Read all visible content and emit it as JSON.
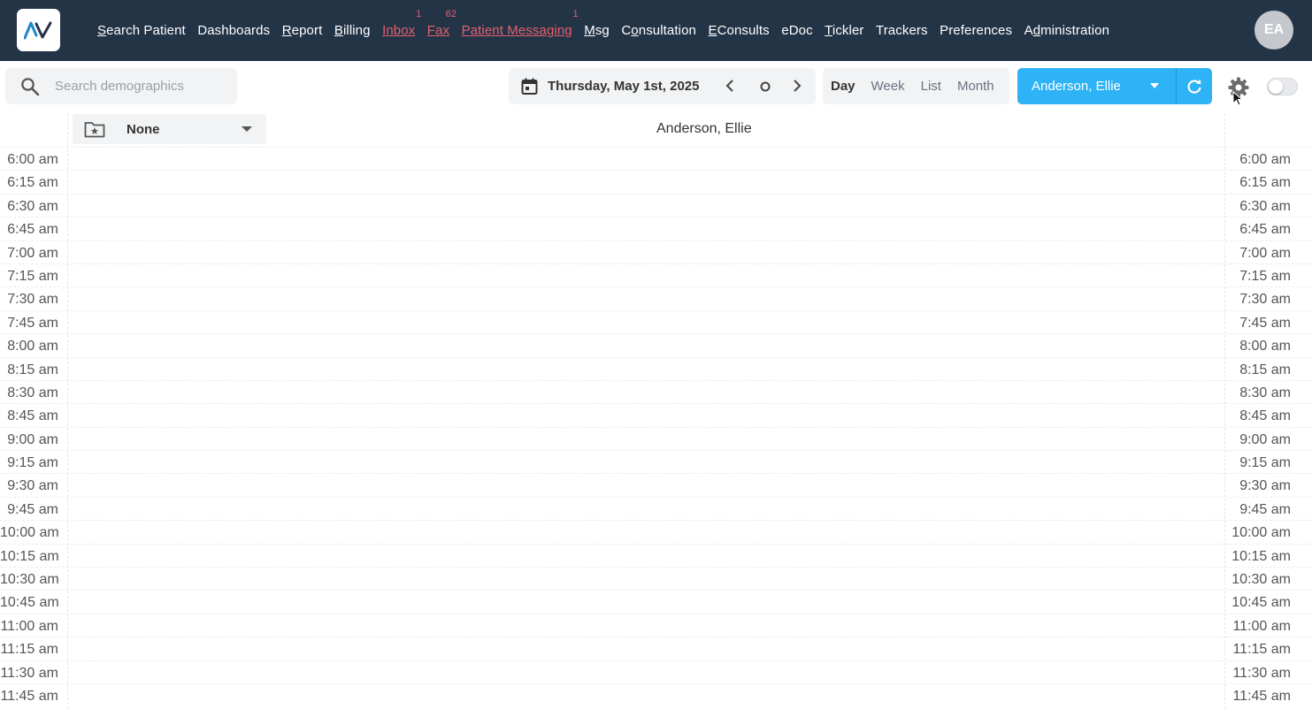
{
  "nav": {
    "items": [
      {
        "pre": "",
        "u": "S",
        "post": "earch Patient",
        "alert": false,
        "badge": ""
      },
      {
        "pre": "Dashboards",
        "u": "",
        "post": "",
        "alert": false,
        "badge": ""
      },
      {
        "pre": "",
        "u": "R",
        "post": "eport",
        "alert": false,
        "badge": ""
      },
      {
        "pre": "",
        "u": "B",
        "post": "illing",
        "alert": false,
        "badge": ""
      },
      {
        "pre": "",
        "u": "",
        "post": "Inbox",
        "alert": true,
        "badge": "1"
      },
      {
        "pre": "",
        "u": "",
        "post": "Fax",
        "alert": true,
        "badge": "62"
      },
      {
        "pre": "",
        "u": "",
        "post": "Patient Messaging",
        "alert": true,
        "badge": "1"
      },
      {
        "pre": "",
        "u": "M",
        "post": "sg",
        "alert": false,
        "badge": ""
      },
      {
        "pre": "C",
        "u": "o",
        "post": "nsultation",
        "alert": false,
        "badge": ""
      },
      {
        "pre": "",
        "u": "E",
        "post": "Consults",
        "alert": false,
        "badge": ""
      },
      {
        "pre": "eDoc",
        "u": "",
        "post": "",
        "alert": false,
        "badge": ""
      },
      {
        "pre": "",
        "u": "T",
        "post": "ickler",
        "alert": false,
        "badge": ""
      },
      {
        "pre": "Trackers",
        "u": "",
        "post": "",
        "alert": false,
        "badge": ""
      },
      {
        "pre": "Preferences",
        "u": "",
        "post": "",
        "alert": false,
        "badge": ""
      },
      {
        "pre": "A",
        "u": "d",
        "post": "ministration",
        "alert": false,
        "badge": ""
      }
    ],
    "avatar_initials": "EA",
    "background": "#243447",
    "alert_color": "#e4606d"
  },
  "toolbar": {
    "search_placeholder": "Search demographics",
    "date_label": "Thursday, May 1st, 2025",
    "views": [
      "Day",
      "Week",
      "List",
      "Month"
    ],
    "active_view": "Day",
    "provider": "Anderson, Ellie",
    "accent": "#2eb3f6"
  },
  "calendar": {
    "filter_label": "None",
    "column_header": "Anderson, Ellie",
    "times": [
      "6:00 am",
      "6:15 am",
      "6:30 am",
      "6:45 am",
      "7:00 am",
      "7:15 am",
      "7:30 am",
      "7:45 am",
      "8:00 am",
      "8:15 am",
      "8:30 am",
      "8:45 am",
      "9:00 am",
      "9:15 am",
      "9:30 am",
      "9:45 am",
      "10:00 am",
      "10:15 am",
      "10:30 am",
      "10:45 am",
      "11:00 am",
      "11:15 am",
      "11:30 am",
      "11:45 am"
    ]
  }
}
